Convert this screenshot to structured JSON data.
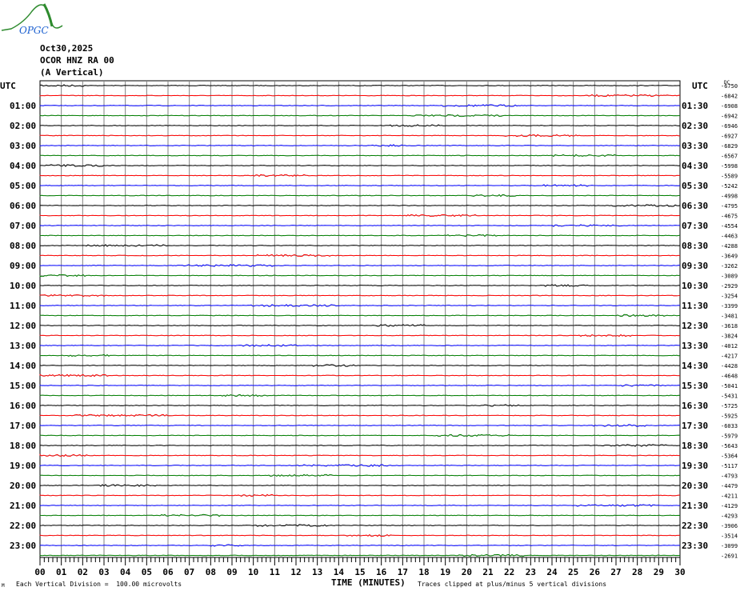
{
  "logo": {
    "text": "OPGC",
    "colors": {
      "curve": "#2e8b2e",
      "text": "#1a5fd0"
    }
  },
  "header": {
    "date": "Oct30,2025",
    "station": "OCOR HNZ RA 00",
    "component": "(A Vertical)"
  },
  "chart_data": {
    "type": "line",
    "subtype": "helicorder",
    "left_axis_title": "UTC",
    "right_axis_title": "UTC",
    "dc_label": "DC",
    "row_minutes": 30,
    "left_labels": [
      "",
      "",
      "01:00",
      "",
      "02:00",
      "",
      "03:00",
      "",
      "04:00",
      "",
      "05:00",
      "",
      "06:00",
      "",
      "07:00",
      "",
      "08:00",
      "",
      "09:00",
      "",
      "10:00",
      "",
      "11:00",
      "",
      "12:00",
      "",
      "13:00",
      "",
      "14:00",
      "",
      "15:00",
      "",
      "16:00",
      "",
      "17:00",
      "",
      "18:00",
      "",
      "19:00",
      "",
      "20:00",
      "",
      "21:00",
      "",
      "22:00",
      "",
      "23:00",
      ""
    ],
    "right_labels": [
      "",
      "",
      "01:30",
      "",
      "02:30",
      "",
      "03:30",
      "",
      "04:30",
      "",
      "05:30",
      "",
      "06:30",
      "",
      "07:30",
      "",
      "08:30",
      "",
      "09:30",
      "",
      "10:30",
      "",
      "11:30",
      "",
      "12:30",
      "",
      "13:30",
      "",
      "14:30",
      "",
      "15:30",
      "",
      "16:30",
      "",
      "17:30",
      "",
      "18:30",
      "",
      "19:30",
      "",
      "20:30",
      "",
      "21:30",
      "",
      "22:30",
      "",
      "23:30",
      ""
    ],
    "dc_offsets": [
      -6750,
      -6842,
      -6908,
      -6942,
      -6946,
      -6927,
      -6829,
      -6567,
      -5998,
      -5589,
      -5242,
      -4998,
      -4795,
      -4675,
      -4554,
      -4463,
      -4288,
      -3649,
      -3262,
      -3089,
      -2929,
      -3254,
      -3399,
      -3481,
      -3618,
      -3824,
      -4012,
      -4217,
      -4428,
      -4648,
      -5041,
      -5431,
      -5725,
      -5925,
      -6033,
      -5979,
      -5643,
      -5364,
      -5117,
      -4793,
      -4479,
      -4211,
      -4129,
      -4293,
      -3906,
      -3514,
      -3099,
      -2691
    ],
    "trace_colors": [
      "#000000",
      "#ff0000",
      "#0000ff",
      "#008000"
    ],
    "x_ticks": [
      "00",
      "01",
      "02",
      "03",
      "04",
      "05",
      "06",
      "07",
      "08",
      "09",
      "10",
      "11",
      "12",
      "13",
      "14",
      "15",
      "16",
      "17",
      "18",
      "19",
      "20",
      "21",
      "22",
      "23",
      "24",
      "25",
      "26",
      "27",
      "28",
      "29",
      "30"
    ],
    "xlabel": "TIME (MINUTES)",
    "xlim": [
      0,
      30
    ],
    "scale_note": "Each Vertical Division =  100.00 microvolts",
    "clip_note": "Traces clipped at plus/minus 5 vertical divisions",
    "corner_mark": "M"
  }
}
